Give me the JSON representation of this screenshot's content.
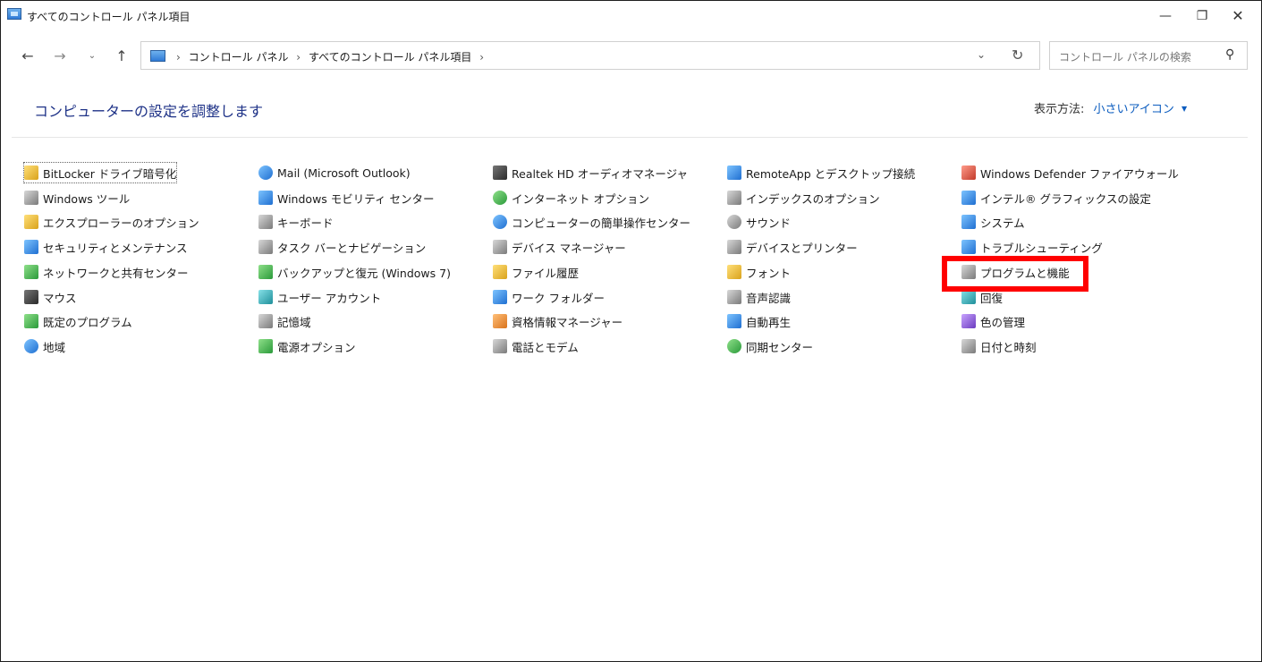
{
  "window": {
    "title": "すべてのコントロール パネル項目",
    "controls": {
      "minimize": "—",
      "maximize": "❐",
      "close": "✕"
    }
  },
  "nav": {
    "back": "←",
    "forward": "→",
    "recent": "⌄",
    "up": "↑",
    "breadcrumb": [
      "コントロール パネル",
      "すべてのコントロール パネル項目"
    ],
    "separator": "›",
    "dropdown": "⌄",
    "refresh": "↻",
    "search_placeholder": "コントロール パネルの検索"
  },
  "header": {
    "title": "コンピューターの設定を調整します",
    "view_by_label": "表示方法:",
    "view_by_value": "小さいアイコン"
  },
  "items": {
    "col1": [
      {
        "label": "BitLocker ドライブ暗号化",
        "icon": "bitlocker-icon"
      },
      {
        "label": "Windows ツール",
        "icon": "windows-tools-icon"
      },
      {
        "label": "エクスプローラーのオプション",
        "icon": "explorer-options-icon"
      },
      {
        "label": "セキュリティとメンテナンス",
        "icon": "security-flag-icon"
      },
      {
        "label": "ネットワークと共有センター",
        "icon": "network-icon"
      },
      {
        "label": "マウス",
        "icon": "mouse-icon"
      },
      {
        "label": "既定のプログラム",
        "icon": "default-programs-icon"
      },
      {
        "label": "地域",
        "icon": "region-icon"
      }
    ],
    "col2": [
      {
        "label": "Mail (Microsoft Outlook)",
        "icon": "mail-icon"
      },
      {
        "label": "Windows モビリティ センター",
        "icon": "mobility-center-icon"
      },
      {
        "label": "キーボード",
        "icon": "keyboard-icon"
      },
      {
        "label": "タスク バーとナビゲーション",
        "icon": "taskbar-icon"
      },
      {
        "label": "バックアップと復元 (Windows 7)",
        "icon": "backup-icon"
      },
      {
        "label": "ユーザー アカウント",
        "icon": "user-accounts-icon"
      },
      {
        "label": "記憶域",
        "icon": "storage-icon"
      },
      {
        "label": "電源オプション",
        "icon": "power-options-icon"
      }
    ],
    "col3": [
      {
        "label": "Realtek HD オーディオマネージャ",
        "icon": "realtek-audio-icon"
      },
      {
        "label": "インターネット オプション",
        "icon": "internet-options-icon"
      },
      {
        "label": "コンピューターの簡単操作センター",
        "icon": "ease-of-access-icon"
      },
      {
        "label": "デバイス マネージャー",
        "icon": "device-manager-icon"
      },
      {
        "label": "ファイル履歴",
        "icon": "file-history-icon"
      },
      {
        "label": "ワーク フォルダー",
        "icon": "work-folders-icon"
      },
      {
        "label": "資格情報マネージャー",
        "icon": "credential-manager-icon"
      },
      {
        "label": "電話とモデム",
        "icon": "phone-modem-icon"
      }
    ],
    "col4": [
      {
        "label": "RemoteApp とデスクトップ接続",
        "icon": "remoteapp-icon"
      },
      {
        "label": "インデックスのオプション",
        "icon": "indexing-icon"
      },
      {
        "label": "サウンド",
        "icon": "sound-icon"
      },
      {
        "label": "デバイスとプリンター",
        "icon": "devices-printers-icon"
      },
      {
        "label": "フォント",
        "icon": "fonts-icon"
      },
      {
        "label": "音声認識",
        "icon": "speech-icon"
      },
      {
        "label": "自動再生",
        "icon": "autoplay-icon"
      },
      {
        "label": "同期センター",
        "icon": "sync-center-icon"
      }
    ],
    "col5": [
      {
        "label": "Windows Defender ファイアウォール",
        "icon": "firewall-icon"
      },
      {
        "label": "インテル® グラフィックスの設定",
        "icon": "intel-graphics-icon"
      },
      {
        "label": "システム",
        "icon": "system-icon"
      },
      {
        "label": "トラブルシューティング",
        "icon": "troubleshooting-icon"
      },
      {
        "label": "プログラムと機能",
        "icon": "programs-features-icon"
      },
      {
        "label": "回復",
        "icon": "recovery-icon"
      },
      {
        "label": "色の管理",
        "icon": "color-management-icon"
      },
      {
        "label": "日付と時刻",
        "icon": "date-time-icon"
      }
    ]
  },
  "colors": {
    "heading": "#1e3287",
    "link": "#0b5cbf",
    "highlight": "#ff0000"
  }
}
